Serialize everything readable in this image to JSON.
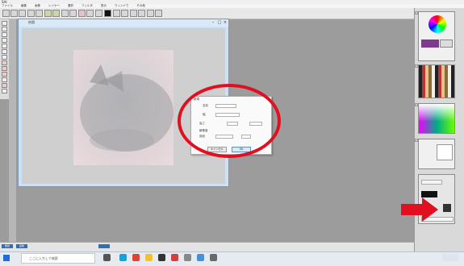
{
  "app": {
    "title": "SAI"
  },
  "menu": {
    "items": [
      "ファイル",
      "編集",
      "画像",
      "レイヤー",
      "選択",
      "フィルタ",
      "表示",
      "ウィンドウ",
      "その他"
    ]
  },
  "canvas": {
    "title_short": "無題"
  },
  "dialog": {
    "title": "新規",
    "labels": [
      "名前",
      "幅",
      "高さ",
      "解像度",
      "用紙"
    ],
    "ok_label": "OK",
    "cancel_label": "キャンセル"
  },
  "statusbar": {
    "tabs": [
      "無題",
      "画像"
    ]
  },
  "taskbar": {
    "search_placeholder": "ここに入力して検索"
  },
  "colors": {
    "highlight": "#e01020",
    "arrow": "#e01020",
    "window_bg": "#9c9c9c"
  }
}
